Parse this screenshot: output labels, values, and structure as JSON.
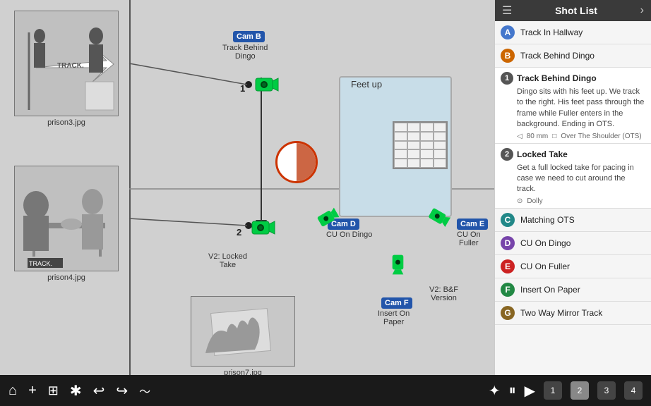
{
  "header": {
    "shot_list_title": "Shot List"
  },
  "shot_list": {
    "rows": [
      {
        "letter": "A",
        "name": "Track In Hallway",
        "color_class": "letter-blue"
      },
      {
        "letter": "B",
        "name": "Track Behind Dingo",
        "color_class": "letter-orange"
      },
      {
        "letter": "C",
        "name": "Matching OTS",
        "color_class": "letter-teal"
      },
      {
        "letter": "D",
        "name": "CU On Dingo",
        "color_class": "letter-purple"
      },
      {
        "letter": "E",
        "name": "CU On Fuller",
        "color_class": "letter-red"
      },
      {
        "letter": "F",
        "name": "Insert On Paper",
        "color_class": "letter-green"
      },
      {
        "letter": "G",
        "name": "Two Way Mirror Track",
        "color_class": "letter-brown"
      }
    ],
    "detail1": {
      "number": "1",
      "title": "Track Behind Dingo",
      "description": "Dingo sits with his feet up. We track to the right. His feet pass through the frame while Fuller enters in the background. Ending in OTS.",
      "lens": "80 mm",
      "shot_type": "Over The Shoulder (OTS)"
    },
    "detail2": {
      "number": "2",
      "title": "Locked Take",
      "description": "Get a full locked take for pacing in case we need to cut around the track.",
      "dolly": "Dolly"
    }
  },
  "scene": {
    "cam_b_label": "Cam B",
    "cam_b_sub": "Track Behind\nDingo",
    "cam_d_label": "Cam D",
    "cam_d_sub": "CU On Dingo",
    "cam_e_label": "Cam E",
    "cam_e_sub": "CU On\nFuller",
    "cam_f_label": "Cam F",
    "cam_f_sub": "Insert On\nPaper",
    "feet_up": "Feet up",
    "v2_1": "V2: Locked\nTake",
    "v2_2": "V2: B&F\nVersion",
    "num1": "1",
    "num2": "2"
  },
  "storyboards": {
    "img1_label": "prison3.jpg",
    "img2_label": "prison4.jpg",
    "img3_label": "prison7.jpg"
  },
  "toolbar": {
    "page_nums": [
      "1",
      "2",
      "3",
      "4"
    ]
  }
}
